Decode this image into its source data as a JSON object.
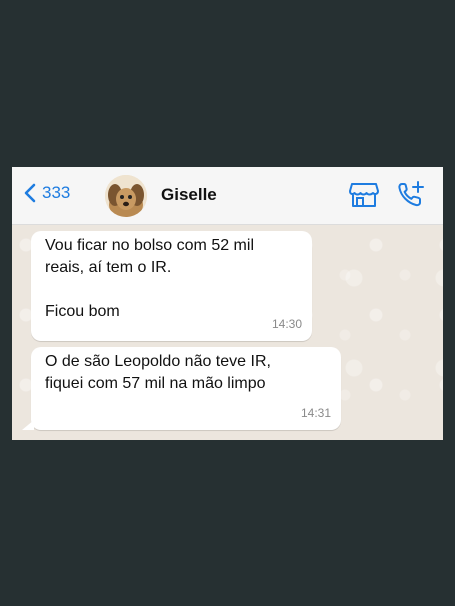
{
  "header": {
    "back_count": "333",
    "contact_name": "Giselle",
    "icons": {
      "back": "chevron-left-icon",
      "store": "storefront-icon",
      "call": "add-call-icon"
    },
    "accent_color": "#1e7ce0"
  },
  "messages": [
    {
      "text": "Vou ficar no bolso com 52 mil\nreais, aí tem o IR.\n\nFicou bom",
      "time": "14:30"
    },
    {
      "text": "O de são Leopoldo não teve IR,\nfiquei com 57 mil na mão limpo",
      "time": "14:31"
    }
  ]
}
